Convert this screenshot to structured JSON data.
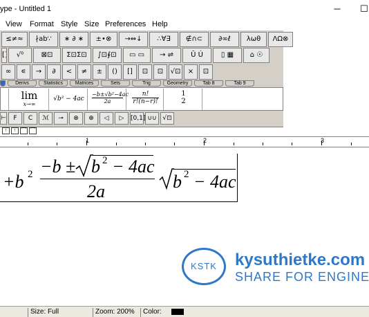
{
  "window": {
    "title": "ype - Untitled 1",
    "minimize": "─",
    "maximize": "☐"
  },
  "menu": [
    "View",
    "Format",
    "Style",
    "Size",
    "Preferences",
    "Help"
  ],
  "palette_row1": [
    "≤≠≈",
    "∤ab∵",
    "∗ ∂ ∗",
    "±•⊗",
    "→⇔↓",
    "∴∀∃",
    "∉∩⊂",
    "∂∞ℓ",
    "λωθ",
    "ΛΩ⊗"
  ],
  "palette_row2": [
    "[]",
    "√⁰",
    "⊠⊡",
    "Σ⊡Σ⊡",
    "∫⊡∮⊡",
    "▭ ▭",
    "→ ⇌",
    "Ū Ú",
    "▯ ▦",
    "⌂ ☉"
  ],
  "palette_row3": [
    "∞",
    "∊",
    "→",
    "∂",
    "<",
    "≠",
    "±",
    "()",
    "[]",
    "⊡",
    "⊡",
    "√⊡",
    "×",
    "⊡"
  ],
  "tabs": [
    "",
    "Derivs",
    "Statistics",
    "Matrices",
    "Sets",
    "Trig",
    "Geometry",
    "Tab 8",
    "Tab 9"
  ],
  "templates": {
    "lim_top": "lim",
    "lim_bottom": "x→∞",
    "sqrt_b2": "√b² − 4ac",
    "quad_top": "−b±√b²−4ac",
    "quad_bottom": "2a",
    "fact_top": "n!",
    "fact_bottom": "r!(n−r)!",
    "vec_top": "1",
    "vec_bottom": "2"
  },
  "palette_row4": [
    "⊢",
    "F",
    "C",
    "ℳ",
    "⊸",
    "⊗",
    "⊕",
    "◁",
    "▷",
    "[0,1]",
    "∪∪",
    "√⊡"
  ],
  "size_buttons": [
    "↑",
    "↑",
    "⌒",
    "⌒"
  ],
  "ruler_numbers": [
    "1",
    "2",
    "3"
  ],
  "equation": {
    "plus_b2": "+b",
    "exp2": "2",
    "num_minus_b": "−b ±",
    "num_rad": "b",
    "num_rad_exp": "2",
    "num_rest": "− 4ac",
    "den": "2a",
    "sqrt_b": "b",
    "sqrt_exp": "2",
    "sqrt_rest": "− 4ac"
  },
  "watermark": {
    "logo_text": "KSTK",
    "site": "kysuthietke.com",
    "tagline": "SHARE FOR ENGINEE"
  },
  "status": {
    "size": "Size: Full",
    "zoom": "Zoom: 200%",
    "color": "Color:"
  },
  "colors": {
    "accent": "#2e78c7",
    "palette_bg": "#d4d0c8",
    "swatch": "#000000"
  }
}
